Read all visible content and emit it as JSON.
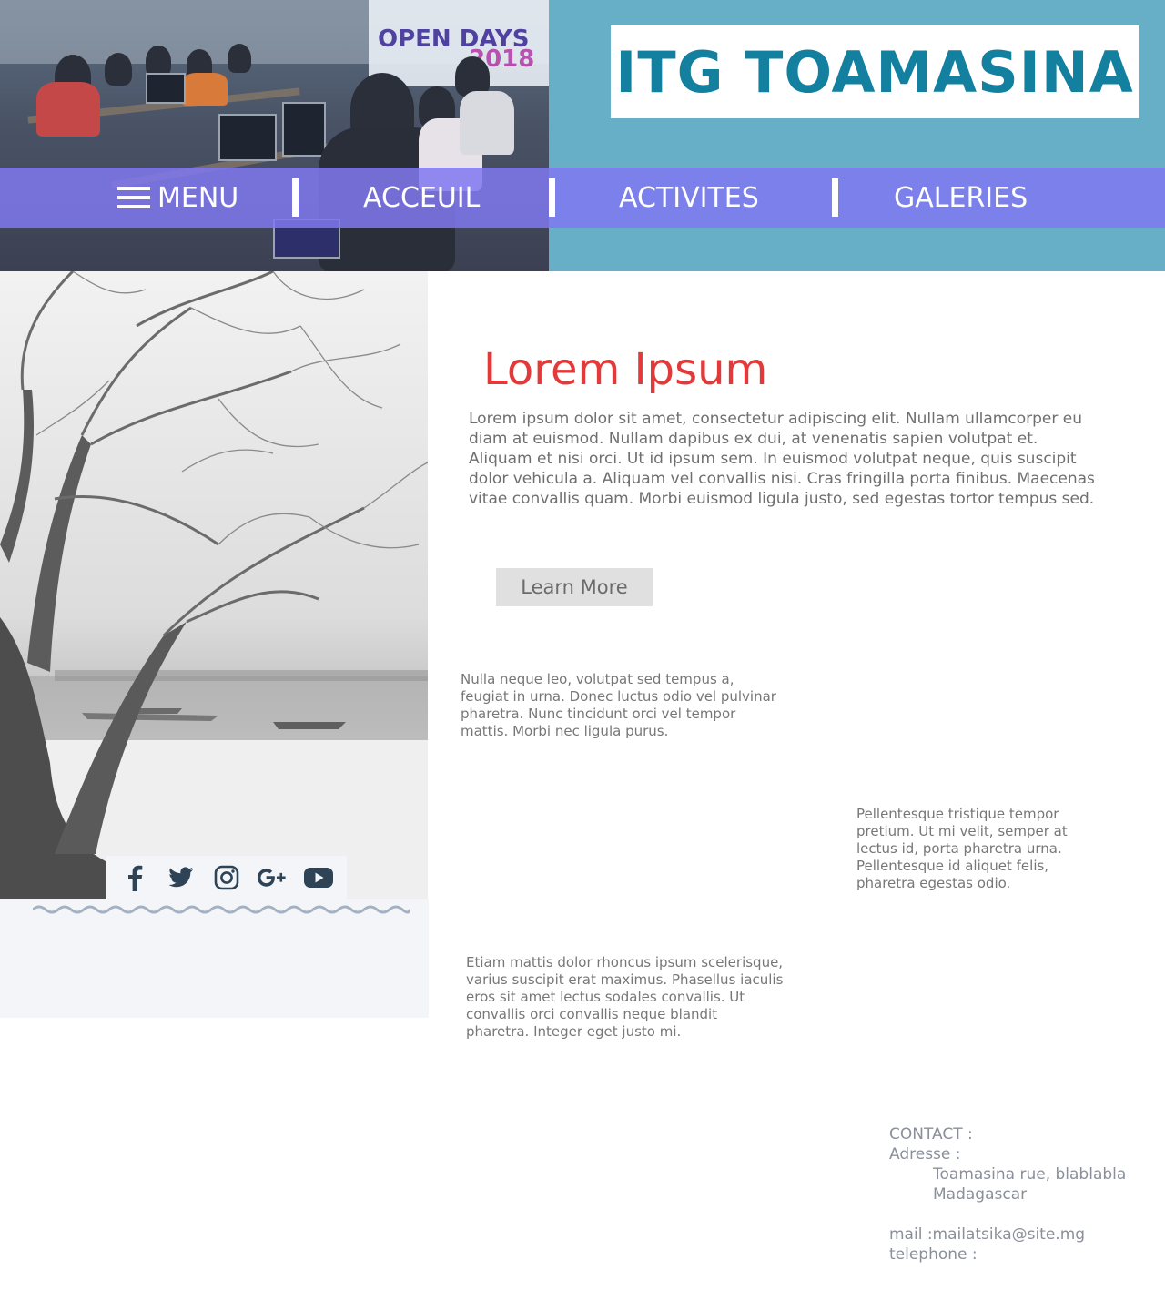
{
  "header": {
    "title": "ITG TOAMASINA",
    "photo_banner_text": "OPEN DAYS",
    "photo_banner_year": "2018"
  },
  "nav": {
    "menu_label": "MENU",
    "items": [
      {
        "label": "ACCEUIL"
      },
      {
        "label": "ACTIVITES"
      },
      {
        "label": "GALERIES"
      }
    ]
  },
  "main": {
    "heading": "Lorem Ipsum",
    "lead": "Lorem ipsum dolor sit amet, consectetur adipiscing elit. Nullam ullamcorper eu diam at euismod. Nullam dapibus ex dui, at venenatis sapien volutpat et. Aliquam et nisi orci. Ut id ipsum sem. In euismod volutpat neque, quis suscipit dolor vehicula a. Aliquam vel convallis nisi. Cras fringilla porta finibus. Maecenas vitae convallis quam. Morbi euismod ligula justo, sed egestas tortor tempus sed.",
    "button_label": "Learn More",
    "paragraphs": [
      "Nulla neque leo, volutpat sed tempus a, feugiat in urna. Donec luctus odio vel pulvinar pharetra. Nunc tincidunt orci vel tempor mattis. Morbi nec ligula purus.",
      "Pellentesque tristique tempor pretium. Ut mi velit, semper at lectus id, porta pharetra urna. Pellentesque id aliquet felis, pharetra egestas odio.",
      "Etiam mattis dolor rhoncus ipsum scelerisque, varius suscipit erat maximus. Phasellus iaculis eros sit amet lectus sodales convallis. Ut convallis orci convallis neque blandit pharetra. Integer eget justo mi."
    ]
  },
  "socials": {
    "icons": [
      "facebook-icon",
      "twitter-icon",
      "instagram-icon",
      "google-plus-icon",
      "youtube-icon"
    ],
    "icon_color": "#2f4356"
  },
  "contact": {
    "title": "CONTACT :",
    "address_label": "Adresse :",
    "address_line1": "Toamasina rue, blablabla",
    "address_line2": "Madagascar",
    "mail": "mail :mailatsika@site.mg",
    "telephone": "telephone :"
  },
  "colors": {
    "header_bg": "#66afc7",
    "title": "#13809f",
    "nav_bg": "#8078f0",
    "heading": "#e23a3a",
    "button_bg": "#e0e0e0",
    "panel_bg": "#f4f5f9"
  }
}
